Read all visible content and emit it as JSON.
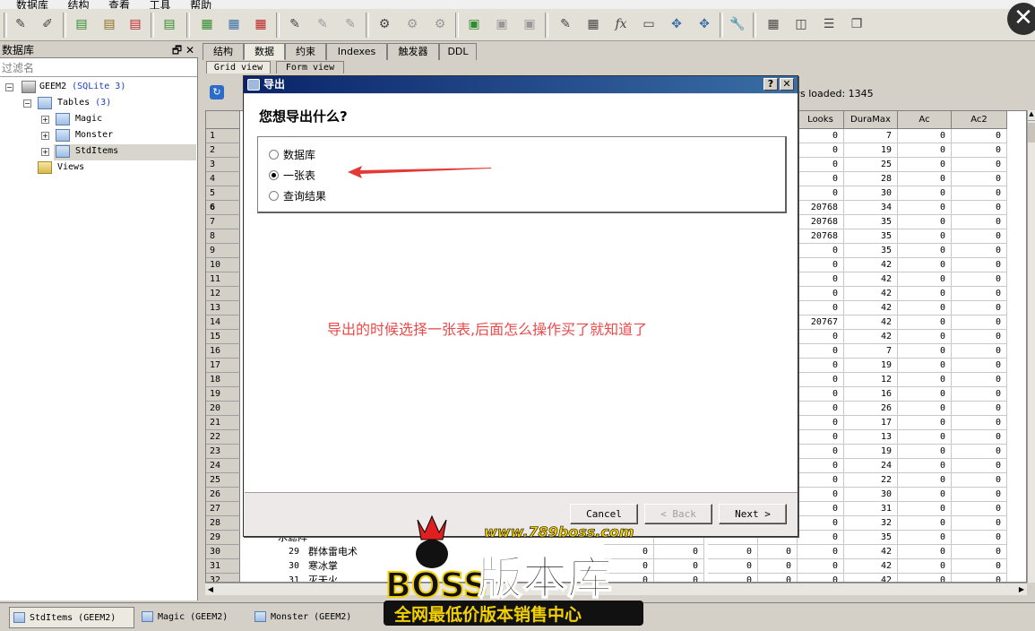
{
  "menu": [
    "数据库",
    "结构",
    "查看",
    "工具",
    "帮助"
  ],
  "toolbar_icons": [
    "connect-icon",
    "disconnect-icon",
    "add-db-icon",
    "edit-db-icon",
    "remove-db-icon",
    "refresh-db-icon",
    "new-table-icon",
    "edit-table-icon",
    "drop-table-icon",
    "new-index-icon",
    "edit-index-icon",
    "drop-index-icon",
    "new-trigger-icon",
    "edit-trigger-icon",
    "drop-trigger-icon",
    "new-view-icon",
    "edit-view-icon",
    "drop-view-icon",
    "sql-editor-icon",
    "export-icon",
    "function-icon",
    "collation-icon",
    "extension-icon",
    "extension2-icon",
    "settings-icon",
    "tile-icon",
    "tile-vertical-icon",
    "tile-horizontal-icon",
    "cascade-icon"
  ],
  "left_panel": {
    "title": "数据库",
    "pin": "🗗",
    "close": "✕",
    "filter_placeholder": "过滤名",
    "db_name": "GEEM2",
    "db_type": "(SQLite 3)",
    "tables_label": "Tables",
    "tables_count": "(3)",
    "tables": [
      "Magic",
      "Monster",
      "StdItems"
    ],
    "views_label": "Views"
  },
  "tabs": [
    "结构",
    "数据",
    "约束",
    "Indexes",
    "触发器",
    "DDL"
  ],
  "active_tab": "数据",
  "subtabs": [
    "Grid view",
    "Form view"
  ],
  "rows_loaded": "ws loaded: 1345",
  "grid": {
    "columns": [
      "Looks",
      "DuraMax",
      "Ac",
      "Ac2"
    ],
    "row_numbers": [
      "1",
      "2",
      "3",
      "4",
      "5",
      "6",
      "7",
      "8",
      "9",
      "10",
      "11",
      "12",
      "13",
      "14",
      "15",
      "16",
      "17",
      "18",
      "19",
      "20",
      "21",
      "22",
      "23",
      "24",
      "25",
      "26",
      "27",
      "28",
      "29",
      "30",
      "31",
      "32"
    ],
    "looks": [
      "0",
      "0",
      "0",
      "0",
      "0",
      "20768",
      "20768",
      "20768",
      "0",
      "0",
      "0",
      "0",
      "0",
      "20767",
      "0",
      "0",
      "0",
      "0",
      "0",
      "0",
      "0",
      "0",
      "0",
      "0",
      "0",
      "0",
      "0",
      "0",
      "0",
      "0",
      "0",
      "0"
    ],
    "duramax": [
      "7",
      "19",
      "25",
      "28",
      "30",
      "34",
      "35",
      "35",
      "35",
      "42",
      "42",
      "42",
      "42",
      "42",
      "42",
      "7",
      "19",
      "12",
      "16",
      "26",
      "17",
      "13",
      "19",
      "24",
      "22",
      "30",
      "31",
      "32",
      "35",
      "42",
      "42",
      "42"
    ],
    "ac": [
      "0",
      "0",
      "0",
      "0",
      "0",
      "0",
      "0",
      "0",
      "0",
      "0",
      "0",
      "0",
      "0",
      "0",
      "0",
      "0",
      "0",
      "0",
      "0",
      "0",
      "0",
      "0",
      "0",
      "0",
      "0",
      "0",
      "0",
      "0",
      "0",
      "0",
      "0",
      "0"
    ],
    "ac2": [
      "0",
      "0",
      "0",
      "0",
      "0",
      "0",
      "0",
      "0",
      "0",
      "0",
      "0",
      "0",
      "0",
      "0",
      "0",
      "0",
      "0",
      "0",
      "0",
      "0",
      "0",
      "0",
      "0",
      "0",
      "0",
      "0",
      "0",
      "0",
      "0",
      "0",
      "0",
      "0"
    ],
    "bottom_rows": [
      {
        "idx": "29",
        "name": "群体雷电术"
      },
      {
        "idx": "30",
        "name": "寒冰掌"
      },
      {
        "idx": "31",
        "name": "灭天火"
      }
    ],
    "bottom_partial_name": "水滤阵"
  },
  "bottom_tabs": [
    "StdItems (GEEM2)",
    "Magic (GEEM2)",
    "Monster (GEEM2)"
  ],
  "dialog": {
    "title": "导出",
    "help": "?",
    "close": "✕",
    "question": "您想导出什么?",
    "options": [
      "数据库",
      "一张表",
      "查询结果"
    ],
    "selected": "一张表",
    "annotation": "导出的时候选择一张表,后面怎么操作买了就知道了",
    "buttons": {
      "cancel": "Cancel",
      "back": "< Back",
      "next": "Next >"
    }
  },
  "watermark": {
    "url": "www.789boss.com",
    "logo": "BOSS",
    "title": "版本库",
    "slogan": "全网最低价版本销售中心"
  },
  "colors": {
    "title_bar": "#0a246a",
    "annotation": "#ea4a4a",
    "arrow": "#e53935"
  }
}
